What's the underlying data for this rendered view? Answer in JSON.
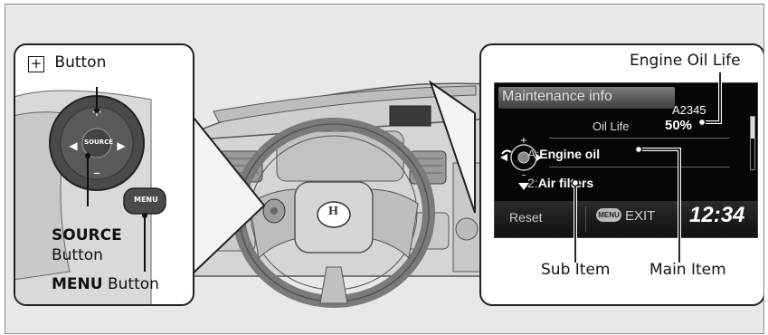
{
  "left_callout": {
    "plus_button_label": "Button",
    "plus_symbol": "+",
    "source_label_bold": "SOURCE",
    "source_label_rest": "Button",
    "menu_label_bold": "MENU",
    "menu_label_rest": " Button",
    "wheel_source_text": "SOURCE",
    "wheel_menu_text": "MENU"
  },
  "display": {
    "header": "Maintenance info",
    "code": "A2345",
    "oil_life_label": "Oil Life",
    "oil_life_value": "50%",
    "item1_prefix": "A:",
    "item1_text": "Engine oil",
    "item2_prefix": "2:",
    "item2_text": "Air filters",
    "reset_label": "Reset",
    "menu_badge": "MENU",
    "exit_label": "EXIT",
    "clock": "12:34"
  },
  "right_callout": {
    "engine_oil_life_label": "Engine Oil Life",
    "sub_item_label": "Sub Item",
    "main_item_label": "Main Item"
  },
  "dashboard_logo": "H",
  "colors": {
    "callout_border": "#222222",
    "display_bg": "#060606",
    "background": "#e8e8e8"
  }
}
